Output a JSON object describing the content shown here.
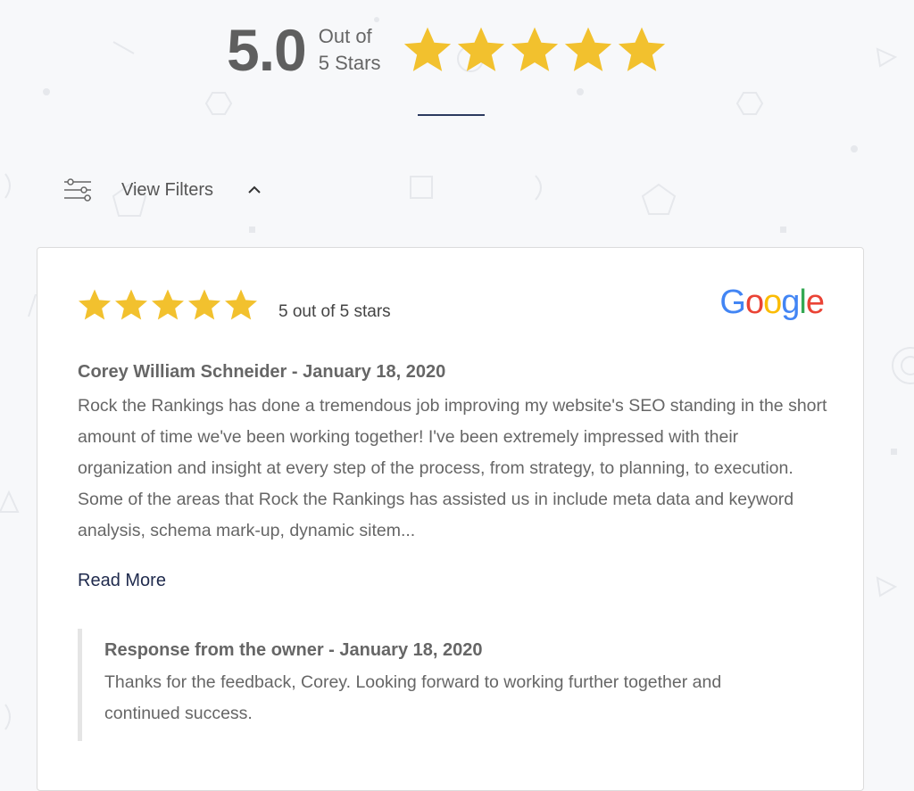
{
  "summary": {
    "score": "5.0",
    "out_of_line1": "Out of",
    "out_of_line2": "5 Stars",
    "star_count": 5,
    "star_color": "#F2C12E"
  },
  "filters": {
    "label": "View Filters",
    "icon": "sliders-icon",
    "toggle_icon": "chevron-up-icon",
    "expanded": true
  },
  "review": {
    "stars": 5,
    "rating_text": "5 out of 5 stars",
    "source": "Google",
    "author_line": "Corey William Schneider - January 18, 2020",
    "text": "Rock the Rankings has done a tremendous job improving my website's SEO standing in the short amount of time we've been working together! I've been extremely impressed with their organization and insight at every step of the process, from strategy, to planning, to execution. Some of the areas that Rock the Rankings has assisted us in include meta data and keyword analysis, schema mark-up, dynamic sitem...",
    "read_more": "Read More",
    "response": {
      "title": "Response from the owner - January 18, 2020",
      "text": "Thanks for the feedback, Corey. Looking forward to working further together and continued success."
    }
  },
  "colors": {
    "accent": "#2B3A5F",
    "link": "#1F2A4D",
    "background": "#F7F8FA"
  }
}
